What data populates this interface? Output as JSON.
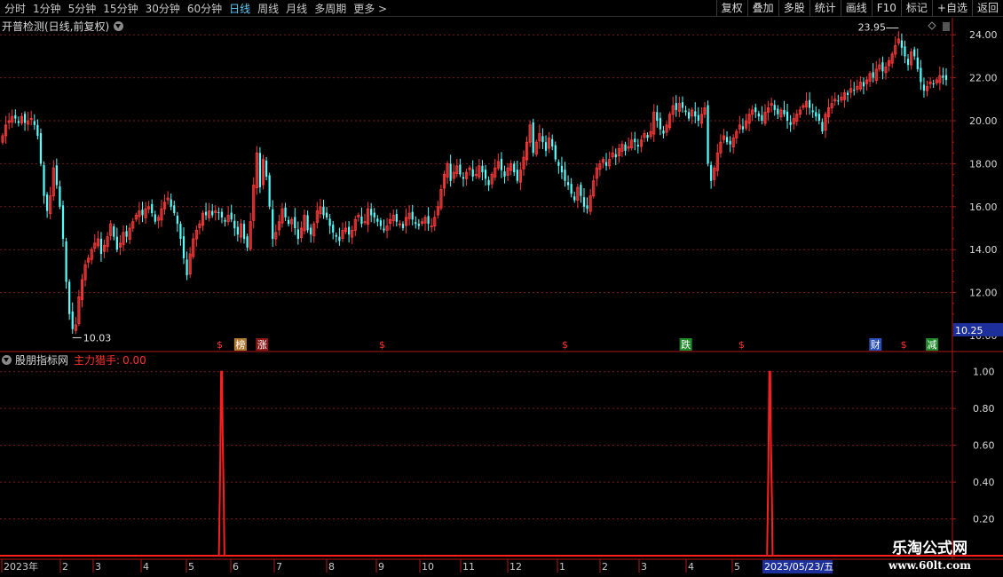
{
  "toolbar": {
    "periods": [
      "分时",
      "1分钟",
      "5分钟",
      "15分钟",
      "30分钟",
      "60分钟",
      "日线",
      "周线",
      "月线",
      "多周期",
      "更多 >"
    ],
    "active_period": "日线",
    "actions": [
      "复权",
      "叠加",
      "多股",
      "统计",
      "画线",
      "F10",
      "标记",
      "+自选",
      "返回"
    ]
  },
  "main_panel": {
    "title": "开普检测(日线,前复权)",
    "price_axis_ticks": [
      "24.00",
      "22.00",
      "20.00",
      "18.00",
      "16.00",
      "14.00",
      "12.00",
      "10.00"
    ],
    "current_price_tag": "10.25",
    "high_annotation": "23.95",
    "low_annotation": "10.03"
  },
  "sub_panel": {
    "name": "股朋指标网",
    "indicator_name": "主力猎手:",
    "indicator_value": "0.00",
    "axis_ticks": [
      "1.00",
      "0.80",
      "0.60",
      "0.40",
      "0.20"
    ]
  },
  "date_axis": {
    "labels": [
      "2023年",
      "2",
      "3",
      "4",
      "5",
      "6",
      "7",
      "8",
      "9",
      "10",
      "11",
      "12",
      "1",
      "2",
      "3",
      "4",
      "5"
    ],
    "cursor_date": "2025/05/23/五"
  },
  "signal_markers": [
    {
      "label": "$",
      "color": "#ff3030",
      "bg": "#000000"
    },
    {
      "label": "榜",
      "color": "#ffffff",
      "bg": "#b07a30"
    },
    {
      "label": "涨",
      "color": "#ffffff",
      "bg": "#8a1818"
    },
    {
      "label": "$",
      "color": "#ff3030",
      "bg": "#000000"
    },
    {
      "label": "$",
      "color": "#ff3030",
      "bg": "#000000"
    },
    {
      "label": "跌",
      "color": "#ffffff",
      "bg": "#1e8a2a"
    },
    {
      "label": "$",
      "color": "#ff3030",
      "bg": "#000000"
    },
    {
      "label": "财",
      "color": "#ffffff",
      "bg": "#2a4fb8"
    },
    {
      "label": "$",
      "color": "#ff3030",
      "bg": "#000000"
    },
    {
      "label": "减",
      "color": "#ffffff",
      "bg": "#1e8a2a"
    }
  ],
  "watermark": {
    "line1": "乐淘公式网",
    "line2": "www.60lt.com"
  },
  "colors": {
    "up": "#ff3a3a",
    "down": "#54ffff",
    "grid": "#7a1a1a",
    "axis": "#b01818",
    "indicator": "#ff1e1e",
    "price_tag_bg": "#1c2f9a"
  },
  "chart_data": {
    "type": "candlestick",
    "price_range": [
      10,
      24.5
    ],
    "closes": [
      19.3,
      19.8,
      20.0,
      20.2,
      20.1,
      19.9,
      20.2,
      19.9,
      20.0,
      20.1,
      19.8,
      19.3,
      18.0,
      16.5,
      15.8,
      16.5,
      17.8,
      17.0,
      16.0,
      14.5,
      12.5,
      11.0,
      10.3,
      10.5,
      11.8,
      12.6,
      13.3,
      13.6,
      14.0,
      14.3,
      14.5,
      13.8,
      14.2,
      14.6,
      15.2,
      14.6,
      14.0,
      14.3,
      14.8,
      14.6,
      15.0,
      15.3,
      15.6,
      15.8,
      15.6,
      15.9,
      16.0,
      15.7,
      15.3,
      15.5,
      15.9,
      16.2,
      16.4,
      16.0,
      15.7,
      15.2,
      14.5,
      13.6,
      12.8,
      13.8,
      14.5,
      14.9,
      15.2,
      15.7,
      15.6,
      15.8,
      15.6,
      15.8,
      15.7,
      15.5,
      15.3,
      15.6,
      15.4,
      15.0,
      14.7,
      15.2,
      14.5,
      14.1,
      15.3,
      17.0,
      18.5,
      16.9,
      18.2,
      17.4,
      16.0,
      14.5,
      14.8,
      15.3,
      15.9,
      15.5,
      15.2,
      15.4,
      15.0,
      14.5,
      15.0,
      15.6,
      14.9,
      14.7,
      15.2,
      15.8,
      16.0,
      15.6,
      15.5,
      15.1,
      14.8,
      14.6,
      14.4,
      14.9,
      15.0,
      14.7,
      14.9,
      15.4,
      15.6,
      15.2,
      15.3,
      15.9,
      15.6,
      15.5,
      15.3,
      15.1,
      14.9,
      15.1,
      15.4,
      15.6,
      15.3,
      15.2,
      15.0,
      15.5,
      15.7,
      15.4,
      15.2,
      15.1,
      15.3,
      15.5,
      15.2,
      15.1,
      15.5,
      16.0,
      16.8,
      17.5,
      18.0,
      17.2,
      17.6,
      17.9,
      17.5,
      17.3,
      17.6,
      17.8,
      17.4,
      17.5,
      17.9,
      17.6,
      17.3,
      17.0,
      17.5,
      17.8,
      18.1,
      17.7,
      17.4,
      17.8,
      18.0,
      17.6,
      17.2,
      17.7,
      18.3,
      19.0,
      19.8,
      18.5,
      19.0,
      19.4,
      19.0,
      18.6,
      19.2,
      18.8,
      18.2,
      17.9,
      17.6,
      17.2,
      17.0,
      16.6,
      16.3,
      16.9,
      16.5,
      16.0,
      15.9,
      16.5,
      17.2,
      17.8,
      18.0,
      18.2,
      17.9,
      18.2,
      18.5,
      18.3,
      18.7,
      18.9,
      18.6,
      18.8,
      19.1,
      19.0,
      18.8,
      19.1,
      19.4,
      19.2,
      19.5,
      20.4,
      20.0,
      19.6,
      19.4,
      19.8,
      20.3,
      20.7,
      20.5,
      20.8,
      20.6,
      20.4,
      20.1,
      20.5,
      20.2,
      20.0,
      20.3,
      20.6,
      18.0,
      17.2,
      17.8,
      18.5,
      19.0,
      19.3,
      19.0,
      18.9,
      19.2,
      19.5,
      19.8,
      19.6,
      20.0,
      20.3,
      20.5,
      20.4,
      20.2,
      20.0,
      20.4,
      20.6,
      20.8,
      20.5,
      20.3,
      20.5,
      20.3,
      20.0,
      19.8,
      20.1,
      20.3,
      20.5,
      20.7,
      20.9,
      20.6,
      20.4,
      20.2,
      20.0,
      19.5,
      20.3,
      20.6,
      20.8,
      21.0,
      20.9,
      21.1,
      21.3,
      21.2,
      21.5,
      21.4,
      21.6,
      21.8,
      21.6,
      21.9,
      22.2,
      22.0,
      22.4,
      22.6,
      22.3,
      22.5,
      22.8,
      23.1,
      23.5,
      23.8,
      23.4,
      23.0,
      22.6,
      23.2,
      23.0,
      22.4,
      21.8,
      21.4,
      21.6,
      21.8,
      21.7,
      21.9,
      22.1,
      22.0,
      21.9
    ],
    "signal": {
      "spike_positions": [
        0.232,
        0.813
      ],
      "peak_value": 1.0,
      "baseline": 0.0
    },
    "ylim_indicator": [
      0,
      1.1
    ]
  }
}
